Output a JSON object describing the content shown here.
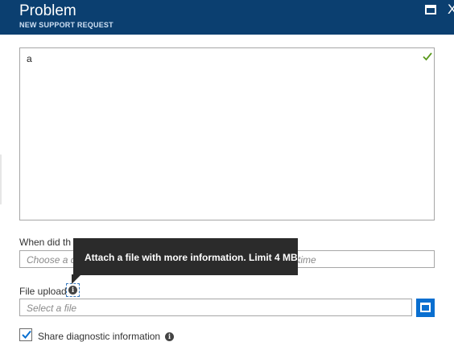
{
  "header": {
    "title": "Problem",
    "subtitle": "NEW SUPPORT REQUEST",
    "bg_color": "#0b3f70",
    "maximize_icon": "maximize-icon",
    "close_icon": "close-icon",
    "close_glyph": "X"
  },
  "problem": {
    "value": "a",
    "valid_icon": "check-icon"
  },
  "when": {
    "label": "When did th",
    "placeholder_left": "Choose a d",
    "placeholder_right": "time"
  },
  "file_upload": {
    "label": "File upload",
    "info_icon": "info-icon",
    "info_glyph": "i",
    "placeholder": "Select a file",
    "browse_icon": "browse-icon"
  },
  "tooltip": {
    "text": "Attach a file with more information. Limit 4 MB."
  },
  "diagnostics": {
    "label": "Share diagnostic information",
    "checked": true,
    "info_glyph": "i"
  },
  "colors": {
    "accent": "#0a6fd0",
    "valid": "#5b9a1e"
  }
}
